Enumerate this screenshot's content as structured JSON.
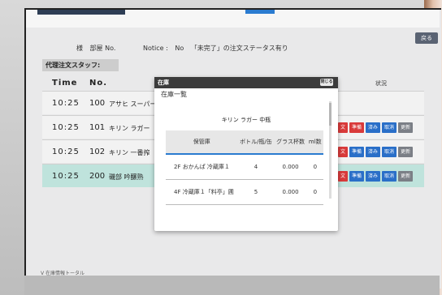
{
  "header": {
    "customer": "様",
    "room_label": "部屋 No.",
    "notice_label": "Notice :",
    "notice_value": "No",
    "notice_text": "「未完了」の注文ステータス有り",
    "back_label": "戻る"
  },
  "staff_label": "代理注文スタッフ:",
  "table": {
    "col_time": "Time",
    "col_no": "No.",
    "col_status": "状況",
    "rows": [
      {
        "time": "10:25",
        "no": "100",
        "name": "アサヒ スーパー"
      },
      {
        "time": "10:25",
        "no": "101",
        "name": "キリン ラガー"
      },
      {
        "time": "10:25",
        "no": "102",
        "name": "キリン 一番搾"
      },
      {
        "time": "10:25",
        "no": "200",
        "name": "磯部 吟醸熟"
      }
    ],
    "actions": [
      "文",
      "準備",
      "済み",
      "取消",
      "更新"
    ]
  },
  "modal": {
    "title": "在庫",
    "close_label": "閉じる",
    "subtitle": "在庫一覧",
    "product": "キリン ラガー 中瓶",
    "columns": [
      "保管庫",
      "ボトル/瓶/缶",
      "グラス杯数",
      "ml数"
    ],
    "rows": [
      {
        "location": "2F おかんぱ 冷蔵庫１",
        "bottles": "4",
        "glasses": "0.000",
        "ml": "0"
      },
      {
        "location": "4F 冷蔵庫１「料亭」圃",
        "bottles": "5",
        "glasses": "0.000",
        "ml": "0"
      }
    ]
  },
  "footer_link": "V 在庫情報トータル"
}
